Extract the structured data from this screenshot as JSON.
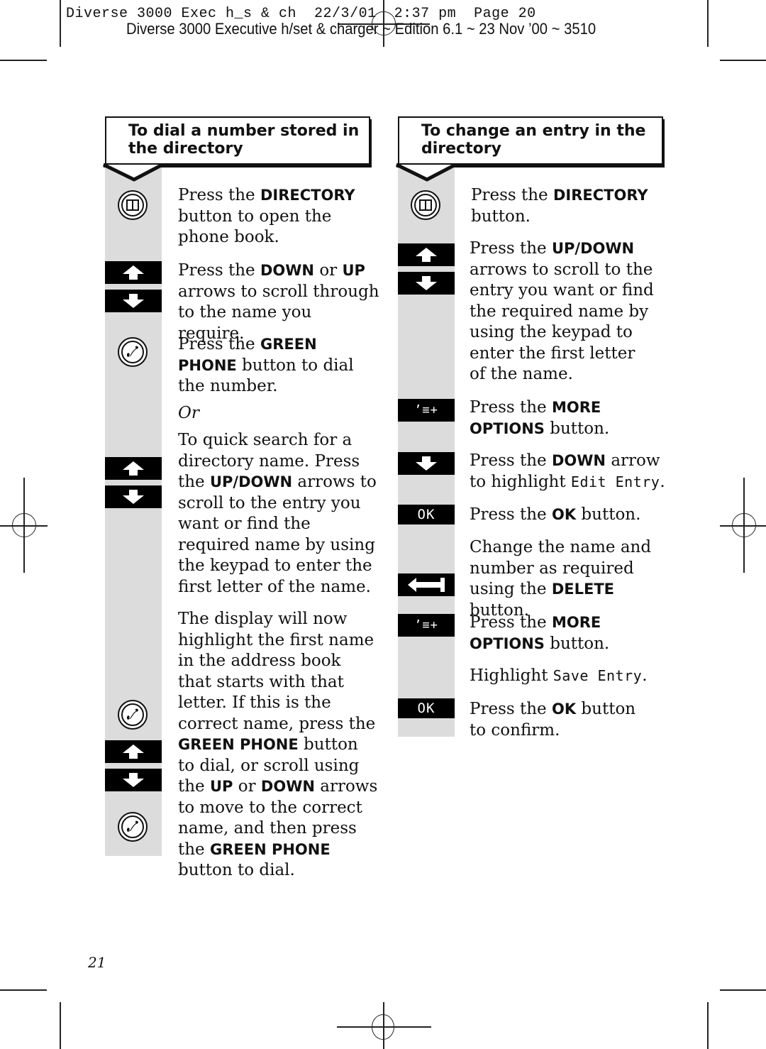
{
  "slug": {
    "line1": "Diverse 3000 Exec h_s & ch  22/3/01  2:37 pm  Page 20",
    "line2": "Diverse 3000 Executive h/set & charger ~ Edition 6.1 ~ 23 Nov ’00 ~ 3510"
  },
  "left_section": {
    "title_line1": "To dial a number stored in",
    "title_line2": "the directory",
    "steps": [
      {
        "icon": "directory-icon",
        "pre": "Press the ",
        "bold": "DIRECTORY",
        "post_lines": [
          " button to open the",
          "phone book."
        ]
      },
      {
        "icon": "up-down-arrows-icon",
        "text": [
          "Press the ",
          "DOWN",
          " or ",
          "UP",
          " arrows to scroll through to the name you require."
        ]
      },
      {
        "icon": "green-phone-icon",
        "pre": "Press the ",
        "bold": "GREEN PHONE",
        "post": " button to dial the number."
      },
      {
        "or": "Or"
      },
      {
        "icon": "up-down-arrows-icon",
        "pre": "To quick search for a directory name. Press the ",
        "bold": "UP/DOWN",
        "post": " arrows to scroll to the entry you want or find the required name by using the keypad to enter the first letter of the name."
      },
      {
        "icon": "green-phone-icon",
        "pre1": "The display will now highlight the first name in the address book that starts with that letter. If this is the correct name, press the ",
        "bold1": "GREEN PHONE",
        "mid1": " button to dial, or scroll using the ",
        "bold2": "UP",
        "mid2": " or ",
        "bold3": "DOWN",
        "mid3": " arrows to move to the correct name, and then press the ",
        "bold4": "GREEN PHONE",
        "post": " button to dial."
      }
    ]
  },
  "right_section": {
    "title_line1": "To change an entry in the",
    "title_line2": "directory",
    "steps": [
      {
        "icon": "directory-icon",
        "pre": "Press the ",
        "bold": "DIRECTORY",
        "post": " button."
      },
      {
        "icon": "up-down-arrows-icon",
        "pre": "Press the ",
        "bold": "UP/DOWN",
        "post": " arrows to scroll to the entry you want or find the required name by using the keypad to enter the first letter of the name."
      },
      {
        "icon": "more-options-icon",
        "pre": "Press the ",
        "bold": "MORE OPTIONS",
        "post": " button."
      },
      {
        "icon": "down-arrow-icon",
        "pre": "Press the ",
        "bold": "DOWN",
        "post": " arrow to highlight ",
        "lcd": "Edit Entry",
        "end": "."
      },
      {
        "icon": "ok-key",
        "key_label": "OK",
        "pre": "Press the ",
        "bold": "OK",
        "post": " button."
      },
      {
        "icon": "delete-icon",
        "pre": "Change the name and number as required using the ",
        "bold": "DELETE",
        "post": " button."
      },
      {
        "icon": "more-options-icon",
        "pre": "Press the ",
        "bold": "MORE OPTIONS",
        "post": " button."
      },
      {
        "pre": "Highlight ",
        "lcd": "Save Entry",
        "end": "."
      },
      {
        "icon": "ok-key",
        "key_label": "OK",
        "pre": "Press the ",
        "bold": "OK",
        "post": " button to confirm."
      }
    ]
  },
  "icons": {
    "more_options_glyph": "’≡+"
  },
  "page_number": "21"
}
